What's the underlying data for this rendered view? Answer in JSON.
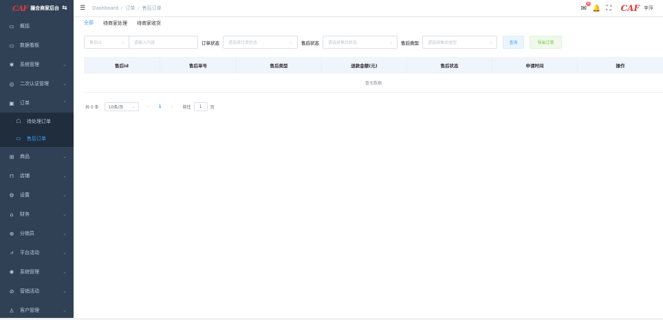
{
  "app": {
    "logo": "CAF",
    "title": "撮合商家后台",
    "swap_icon": "⇆"
  },
  "sidebar": {
    "items": [
      {
        "label": "概括",
        "icon": "monitor-icon",
        "glyph": "▭",
        "chevron": ""
      },
      {
        "label": "数据看板",
        "icon": "monitor-icon",
        "glyph": "▭",
        "chevron": ""
      },
      {
        "label": "系统管理",
        "icon": "gear-icon",
        "glyph": "✱",
        "chevron": "⌄"
      },
      {
        "label": "二次认证管理",
        "icon": "eye-icon",
        "glyph": "◎",
        "chevron": "⌄"
      },
      {
        "label": "订单",
        "icon": "document-icon",
        "glyph": "▣",
        "chevron": "⌃"
      },
      {
        "label": "待处理订单",
        "icon": "bag-icon",
        "glyph": "☖",
        "chevron": "",
        "sub": true
      },
      {
        "label": "售后订单",
        "icon": "truck-icon",
        "glyph": "▭",
        "chevron": "",
        "sub": true,
        "active": true
      },
      {
        "label": "商品",
        "icon": "grid-icon",
        "glyph": "⊞",
        "chevron": "⌄"
      },
      {
        "label": "店铺",
        "icon": "shop-icon",
        "glyph": "⊓",
        "chevron": "⌄"
      },
      {
        "label": "设置",
        "icon": "settings-icon",
        "glyph": "⚙",
        "chevron": "⌄"
      },
      {
        "label": "财务",
        "icon": "wallet-icon",
        "glyph": "⌂",
        "chevron": "⌄"
      },
      {
        "label": "分销员",
        "icon": "globe-icon",
        "glyph": "⊕",
        "chevron": "⌄"
      },
      {
        "label": "平台活动",
        "icon": "chart-icon",
        "glyph": "⩘",
        "chevron": "⌄"
      },
      {
        "label": "系统管理",
        "icon": "gear-icon",
        "glyph": "✱",
        "chevron": "⌄"
      },
      {
        "label": "营销活动",
        "icon": "compass-icon",
        "glyph": "⊘",
        "chevron": "⌄"
      },
      {
        "label": "客户管理",
        "icon": "user-icon",
        "glyph": "♙",
        "chevron": "⌄"
      }
    ]
  },
  "header": {
    "hamburger": "☰",
    "breadcrumb": [
      "Dashboard",
      "订单",
      "售后订单"
    ],
    "sep": "/",
    "mail_badge": "0",
    "user_logo": "CAF",
    "user_name": "李萍"
  },
  "tabs": [
    {
      "label": "全部",
      "active": true
    },
    {
      "label": "待商家处理",
      "active": false
    },
    {
      "label": "待商家收货",
      "active": false
    }
  ],
  "filters": {
    "field_select": "售后id",
    "search_placeholder": "请输入内容",
    "order_status_label": "订单状态",
    "order_status_placeholder": "请选择订单状态",
    "aftersale_status_label": "售后状态",
    "aftersale_status_placeholder": "请选择售后状态",
    "aftersale_type_label": "售后类型",
    "aftersale_type_placeholder": "请选择售后类型",
    "query_button": "查询",
    "export_button": "导出订单"
  },
  "table": {
    "headers": [
      "售后id",
      "售后单号",
      "售后类型",
      "退款金额(元)",
      "售后状态",
      "申请时间",
      "操作"
    ],
    "empty": "暂无数据"
  },
  "pagination": {
    "total": "共 0 条",
    "page_size": "10条/页",
    "current": "1",
    "goto_label": "前往",
    "goto_value": "1",
    "page_suffix": "页"
  },
  "colors": {
    "sidebar_bg": "#304156",
    "accent": "#409eff",
    "success": "#67c23a",
    "danger": "#e4393c"
  }
}
